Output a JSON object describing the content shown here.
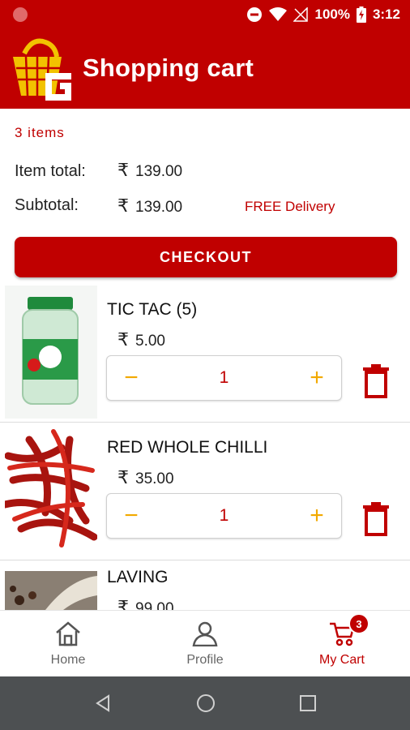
{
  "status_bar": {
    "battery": "100%",
    "time": "3:12"
  },
  "header": {
    "title": "Shopping cart"
  },
  "summary": {
    "items_count": "3 items",
    "item_total_label": "Item total:",
    "item_total_value": "139.00",
    "subtotal_label": "Subtotal:",
    "subtotal_value": "139.00",
    "delivery_note": "FREE Delivery",
    "currency_symbol": "₹"
  },
  "checkout_label": "CHECKOUT",
  "cart": {
    "items": [
      {
        "name": "TIC TAC (5)",
        "price": "5.00",
        "quantity": "1"
      },
      {
        "name": "RED WHOLE CHILLI",
        "price": "35.00",
        "quantity": "1"
      },
      {
        "name": "LAVING",
        "price": "99.00"
      }
    ]
  },
  "stepper": {
    "minus": "−",
    "plus": "+"
  },
  "bottom_nav": {
    "home": "Home",
    "profile": "Profile",
    "my_cart": "My Cart",
    "cart_badge": "3"
  },
  "colors": {
    "brand": "#c00000",
    "accent": "#f2a900",
    "nav_bar": "#4d5052"
  },
  "icons": [
    "basket-logo-icon",
    "rupee-icon",
    "trash-icon",
    "home-icon",
    "profile-icon",
    "cart-icon",
    "back-icon",
    "home-circle-icon",
    "recents-icon"
  ]
}
